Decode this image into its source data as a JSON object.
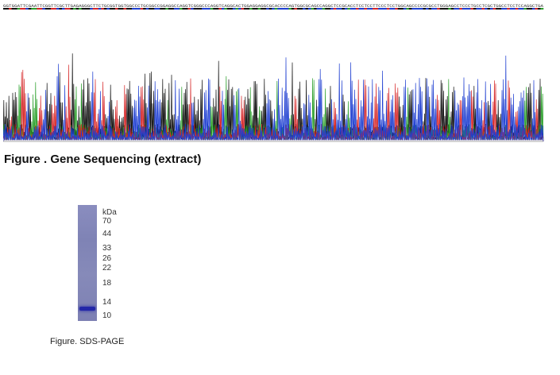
{
  "sequencing": {
    "caption": "Figure . Gene Sequencing (extract)",
    "sequence_text": "GGTGGATTCGAATTCGGTTCGCTTGAGAGGGCTTCTGCGGTGGTGGCCCTGCGGCCGGAGGCCAGGTCGGGCCCAGGTCAGGCACTGGAGGAGGCGCACCCCAGTGGCGCAGCCAGGCTCCGCACCTCCTCCTTCCCTCCTGGCAGCCCCGCGCCTGGGAGCCTCCCTGCCTCGCTGGCCTCCTCCAGGCTGA",
    "base_colors": {
      "A": "#2ca02c",
      "C": "#1f3fd1",
      "G": "#111111",
      "T": "#d62728"
    }
  },
  "sds_page": {
    "caption": "Figure. SDS-PAGE",
    "unit_label": "kDa",
    "markers": [
      "70",
      "44",
      "33",
      "26",
      "22",
      "18",
      "14",
      "10"
    ],
    "lane_color": "#8487b8",
    "band_color": "#2327a8",
    "band_kda": 12
  }
}
